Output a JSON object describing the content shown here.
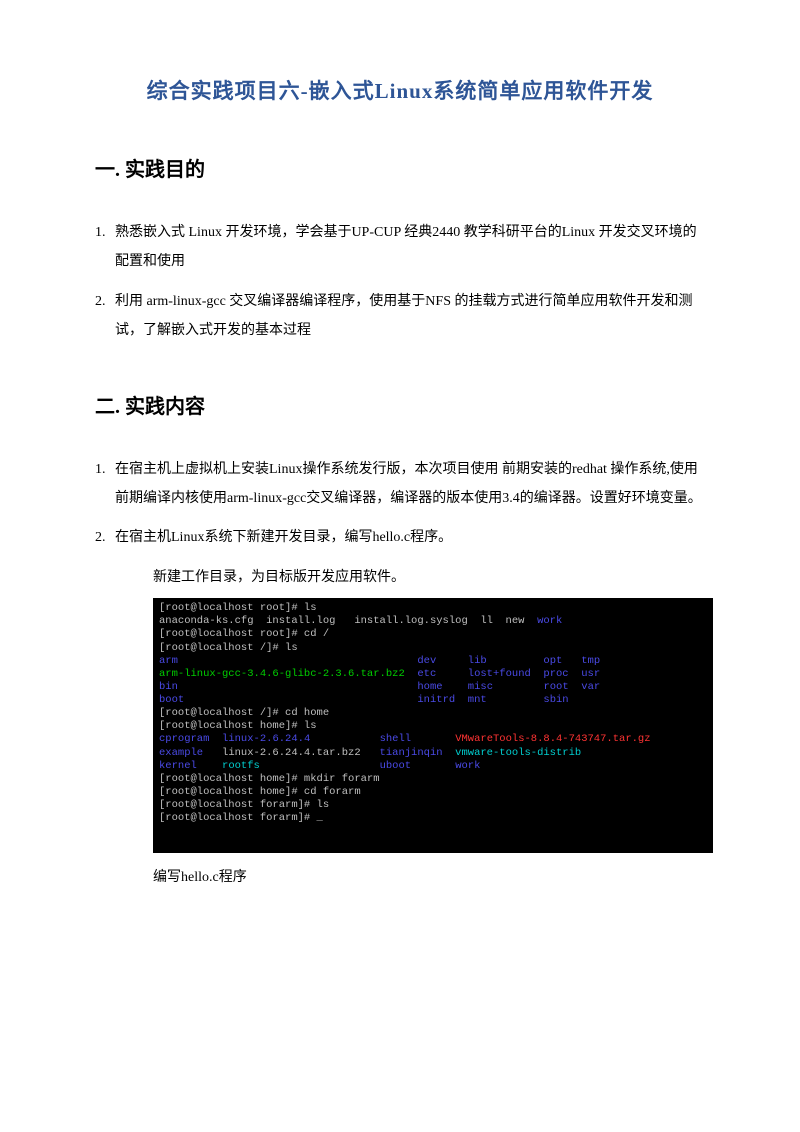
{
  "title": "综合实践项目六-嵌入式Linux系统简单应用软件开发",
  "section1": {
    "heading": "一. 实践目的",
    "items": [
      {
        "num": "1.",
        "text": "熟悉嵌入式 Linux 开发环境，学会基于UP-CUP 经典2440 教学科研平台的Linux 开发交叉环境的配置和使用"
      },
      {
        "num": "2.",
        "text": "利用 arm-linux-gcc 交叉编译器编译程序，使用基于NFS 的挂载方式进行简单应用软件开发和测试，了解嵌入式开发的基本过程"
      }
    ]
  },
  "section2": {
    "heading": "二. 实践内容",
    "items": [
      {
        "num": "1.",
        "text": "在宿主机上虚拟机上安装Linux操作系统发行版，本次项目使用 前期安装的redhat 操作系统,使用前期编译内核使用arm-linux-gcc交叉编译器，编译器的版本使用3.4的编译器。设置好环境变量。"
      },
      {
        "num": "2.",
        "text": "在宿主机Linux系统下新建开发目录，编写hello.c程序。"
      }
    ],
    "sub1": "新建工作目录，为目标版开发应用软件。",
    "sub2": "编写hello.c程序"
  },
  "terminal": {
    "l1": "[root@localhost root]# ls",
    "l2a": "anaconda-ks.cfg  install.log   install.log.syslog  ll  new  ",
    "l2b": "work",
    "l3": "[root@localhost root]# cd /",
    "l4": "[root@localhost /]# ls",
    "l5_arm": "arm",
    "l5_dev": "dev",
    "l5_lib": "lib",
    "l5_opt": "opt",
    "l5_tmp": "tmp",
    "l6_gcc": "arm-linux-gcc-3.4.6-glibc-2.3.6.tar.bz2",
    "l6_etc": "etc",
    "l6_lf": "lost+found",
    "l6_proc": "proc",
    "l6_usr": "usr",
    "l7_bin": "bin",
    "l7_home": "home",
    "l7_misc": "misc",
    "l7_root": "root",
    "l7_var": "var",
    "l8_boot": "boot",
    "l8_initrd": "initrd",
    "l8_mnt": "mnt",
    "l8_sbin": "sbin",
    "l9": "[root@localhost /]# cd home",
    "l10": "[root@localhost home]# ls",
    "l11_cp": "cprogram",
    "l11_lx": "linux-2.6.24.4",
    "l11_sh": "shell",
    "l11_vm": "VMwareTools-8.8.4-743747.tar.gz",
    "l12_ex": "example",
    "l12_lx": "linux-2.6.24.4.tar.bz2",
    "l12_tj": "tianjinqin",
    "l12_vt": "vmware-tools-distrib",
    "l13_ke": "kernel",
    "l13_rf": "rootfs",
    "l13_ub": "uboot",
    "l13_wk": "work",
    "l14": "[root@localhost home]# mkdir forarm",
    "l15": "[root@localhost home]# cd forarm",
    "l16": "[root@localhost forarm]# ls",
    "l17": "[root@localhost forarm]# ",
    "cursor": "_"
  }
}
